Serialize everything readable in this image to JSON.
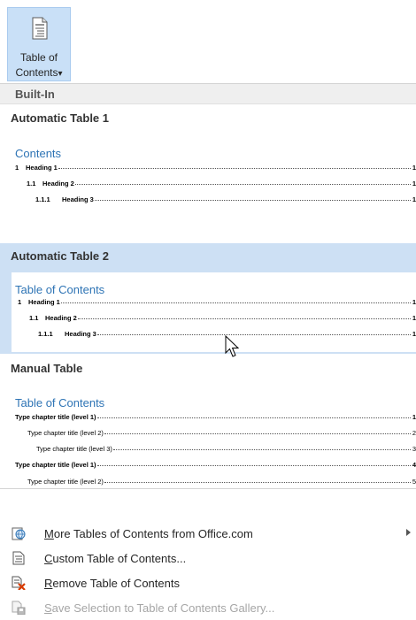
{
  "ribbon": {
    "button_line1": "Table of",
    "button_line2": "Contents",
    "dropdown_glyph": "▾"
  },
  "gallery": {
    "category": "Built-In",
    "items": [
      {
        "title": "Automatic Table 1",
        "heading": "Contents",
        "lines": [
          {
            "num": "1",
            "text": "Heading 1",
            "page": "1"
          },
          {
            "num": "1.1",
            "text": "Heading 2",
            "page": "1"
          },
          {
            "num": "1.1.1",
            "text": "Heading 3",
            "page": "1"
          }
        ]
      },
      {
        "title": "Automatic Table 2",
        "heading": "Table of Contents",
        "selected": true,
        "lines": [
          {
            "num": "1",
            "text": "Heading 1",
            "page": "1"
          },
          {
            "num": "1.1",
            "text": "Heading 2",
            "page": "1"
          },
          {
            "num": "1.1.1",
            "text": "Heading 3",
            "page": "1"
          }
        ]
      },
      {
        "title": "Manual Table",
        "heading": "Table of Contents",
        "lines": [
          {
            "text": "Type chapter title (level 1)",
            "page": "1"
          },
          {
            "text": "Type chapter title (level 2)",
            "page": "2"
          },
          {
            "text": "Type chapter title (level 3)",
            "page": "3"
          },
          {
            "text": "Type chapter title (level 1)",
            "page": "4"
          },
          {
            "text": "Type chapter title (level 2)",
            "page": "5"
          }
        ]
      }
    ]
  },
  "menu": {
    "items": [
      {
        "accel": "M",
        "rest": "ore Tables of Contents from Office.com",
        "icon": "office-globe-icon",
        "submenu": true
      },
      {
        "accel": "C",
        "rest": "ustom Table of Contents...",
        "icon": "custom-toc-icon"
      },
      {
        "accel": "R",
        "rest": "emove Table of Contents",
        "icon": "remove-toc-icon"
      },
      {
        "accel": "S",
        "rest": "ave Selection to Table of Contents Gallery...",
        "icon": "save-selection-icon",
        "disabled": true
      }
    ]
  },
  "colors": {
    "accent_heading": "#2e74b5",
    "selection": "#cde0f4",
    "ribbon_pressed": "#c9e0f7"
  }
}
